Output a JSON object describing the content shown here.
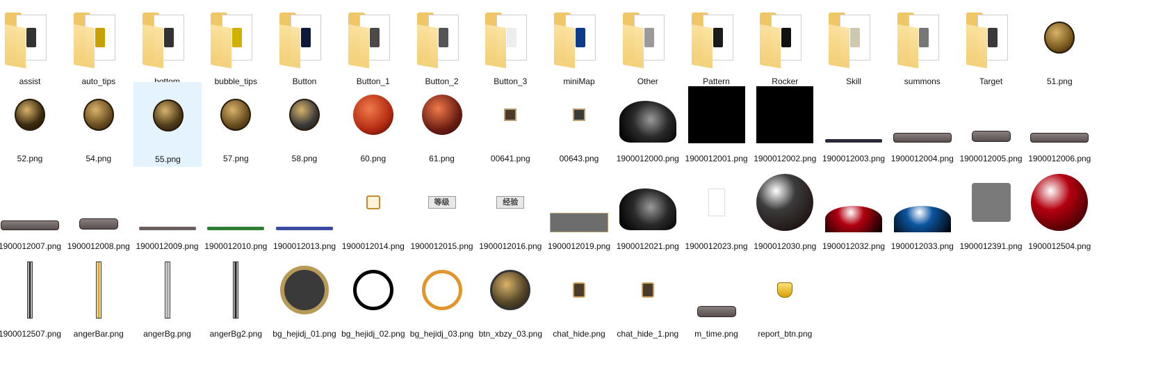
{
  "files": [
    {
      "label": "assist",
      "kind": "folder",
      "preview": "#333333"
    },
    {
      "label": "auto_tips",
      "kind": "folder",
      "preview": "#c8a000"
    },
    {
      "label": "bottom",
      "kind": "folder",
      "preview": "#333333"
    },
    {
      "label": "bubble_tips",
      "kind": "folder",
      "preview": "#d2b000"
    },
    {
      "label": "Button",
      "kind": "folder",
      "preview": "#0e1a3a"
    },
    {
      "label": "Button_1",
      "kind": "folder",
      "preview": "#4a4a4a"
    },
    {
      "label": "Button_2",
      "kind": "folder",
      "preview": "#555555"
    },
    {
      "label": "Button_3",
      "kind": "folder",
      "preview": "#eeeeee"
    },
    {
      "label": "miniMap",
      "kind": "folder",
      "preview": "#0b3b8a"
    },
    {
      "label": "Other",
      "kind": "folder",
      "preview": "#9a9a9a"
    },
    {
      "label": "Pattern",
      "kind": "folder",
      "preview": "#1a1a1a"
    },
    {
      "label": "Rocker",
      "kind": "folder",
      "preview": "#111111"
    },
    {
      "label": "Skill",
      "kind": "folder",
      "preview": "#cfc8b0"
    },
    {
      "label": "summons",
      "kind": "folder",
      "preview": "#777777"
    },
    {
      "label": "Target",
      "kind": "folder",
      "preview": "#3a3a3a"
    },
    {
      "label": "51.png",
      "kind": "ornament",
      "color": "#7a5a1e"
    },
    {
      "label": "52.png",
      "kind": "ornament",
      "color": "#3a2a10"
    },
    {
      "label": "54.png",
      "kind": "ornament",
      "color": "#6a4e20"
    },
    {
      "label": "55.png",
      "kind": "ornament",
      "color": "#4d3a18",
      "selected": true
    },
    {
      "label": "57.png",
      "kind": "ornament",
      "color": "#6a4e20"
    },
    {
      "label": "58.png",
      "kind": "ornament",
      "color": "#3a3a3a"
    },
    {
      "label": "60.png",
      "kind": "orb",
      "color": "#b32a10"
    },
    {
      "label": "61.png",
      "kind": "orb",
      "color": "#6a1c12"
    },
    {
      "label": "00641.png",
      "kind": "smallbox",
      "color": "#4a3a2a"
    },
    {
      "label": "00643.png",
      "kind": "smallbox",
      "color": "#3a3a3a"
    },
    {
      "label": "1900012000.png",
      "kind": "dragonorb",
      "color": "#2a2a2a"
    },
    {
      "label": "1900012001.png",
      "kind": "block",
      "color": "#000000"
    },
    {
      "label": "1900012002.png",
      "kind": "block",
      "color": "#000000"
    },
    {
      "label": "1900012003.png",
      "kind": "thinbar",
      "color": "#2a2a3a"
    },
    {
      "label": "1900012004.png",
      "kind": "bar",
      "color": "#5a4f4f"
    },
    {
      "label": "1900012005.png",
      "kind": "pill",
      "color": "#5a4f4f"
    },
    {
      "label": "1900012006.png",
      "kind": "bar",
      "color": "#5a4f4f"
    },
    {
      "label": "1900012007.png",
      "kind": "bar",
      "color": "#5a4f4f"
    },
    {
      "label": "1900012008.png",
      "kind": "pill",
      "color": "#5a4f4f"
    },
    {
      "label": "1900012009.png",
      "kind": "thinbar",
      "color": "#6a5f5f"
    },
    {
      "label": "1900012010.png",
      "kind": "thinbar",
      "color": "#2e7d32"
    },
    {
      "label": "1900012013.png",
      "kind": "thinbar",
      "color": "#3a4aa0"
    },
    {
      "label": "1900012014.png",
      "kind": "smallicon",
      "color": "#c58a2a"
    },
    {
      "label": "1900012015.png",
      "kind": "textbadge",
      "color": "#444444",
      "text": "等级"
    },
    {
      "label": "1900012016.png",
      "kind": "textbadge",
      "color": "#444444",
      "text": "经验"
    },
    {
      "label": "1900012019.png",
      "kind": "rect",
      "color": "#6d6d6d"
    },
    {
      "label": "1900012021.png",
      "kind": "dragonorb",
      "color": "#2a2a2a"
    },
    {
      "label": "1900012023.png",
      "kind": "whitebox",
      "color": "#ffffff"
    },
    {
      "label": "1900012030.png",
      "kind": "bigorb",
      "color": "#3b3b3b"
    },
    {
      "label": "1900012032.png",
      "kind": "halforb",
      "color": "#b30010"
    },
    {
      "label": "1900012033.png",
      "kind": "halforb",
      "color": "#0b55a0"
    },
    {
      "label": "1900012391.png",
      "kind": "square",
      "color": "#7a7a7a"
    },
    {
      "label": "1900012504.png",
      "kind": "bigorb",
      "color": "#b3000e"
    },
    {
      "label": "1900012507.png",
      "kind": "vbar",
      "color": "#222222"
    },
    {
      "label": "angerBar.png",
      "kind": "vbar",
      "color": "#d8a000"
    },
    {
      "label": "angerBg.png",
      "kind": "vbar",
      "color": "#9a9a9a"
    },
    {
      "label": "angerBg2.png",
      "kind": "vbar",
      "color": "#111111"
    },
    {
      "label": "bg_hejidj_01.png",
      "kind": "frame",
      "color": "#3a3a3a"
    },
    {
      "label": "bg_hejidj_02.png",
      "kind": "ring",
      "color": "#000000"
    },
    {
      "label": "bg_hejidj_03.png",
      "kind": "ring",
      "color": "#e0962a"
    },
    {
      "label": "btn_xbzy_03.png",
      "kind": "medallion",
      "color": "#5a4a2a"
    },
    {
      "label": "chat_hide.png",
      "kind": "chatbtn",
      "color": "#4a3a2a"
    },
    {
      "label": "chat_hide_1.png",
      "kind": "chatbtn",
      "color": "#4a3a2a"
    },
    {
      "label": "m_time.png",
      "kind": "pill",
      "color": "#5a4f4f"
    },
    {
      "label": "report_btn.png",
      "kind": "shield",
      "color": "#d8a000"
    }
  ]
}
